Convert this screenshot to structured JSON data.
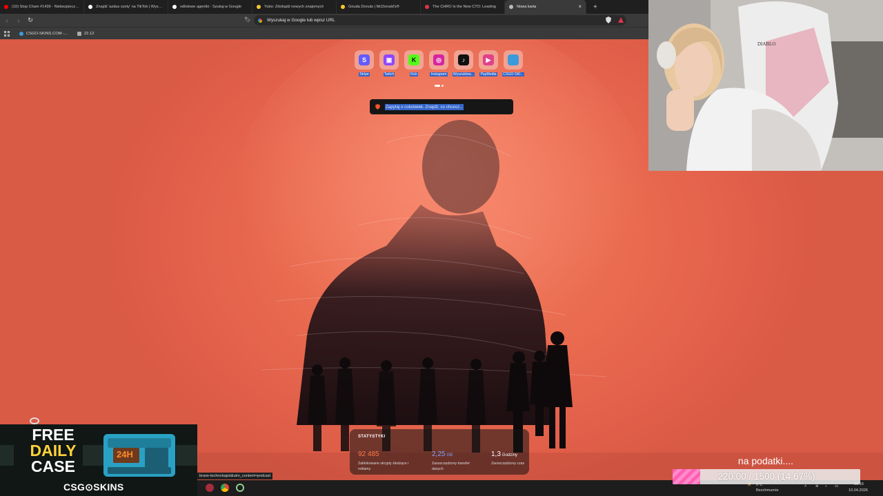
{
  "browser": {
    "tabs": [
      {
        "title": "(10) Stop Cham #1439 - Niebezpieczne",
        "favicon_color": "#ff0000",
        "active": false
      },
      {
        "title": "Znajdź 'azdus szoty' na TikTok | Wyszukaj",
        "favicon_color": "#ffffff",
        "active": false
      },
      {
        "title": "odlotowe agentki - Szukaj w Google",
        "favicon_color": "#ffffff",
        "active": false
      },
      {
        "title": "Yubo: Zdobądź nowych znajomych",
        "favicon_color": "#f4c534",
        "active": false
      },
      {
        "title": "Gouda Donuts | McDonald's®",
        "favicon_color": "#ffc72c",
        "active": false
      },
      {
        "title": "The CHRO Is the New CTO: Leading",
        "favicon_color": "#e0334b",
        "active": false
      },
      {
        "title": "Nowa karta",
        "favicon_color": "#bbbbbb",
        "active": true
      }
    ],
    "new_tab_symbol": "+",
    "address_bar": {
      "placeholder": "Wyszukaj w Google lub wpisz URL"
    },
    "bookmarks": [
      {
        "label": "CSGO-SKINS.COM -...",
        "favicon_color": "#3a9bdc"
      },
      {
        "label": "22.12",
        "favicon_color": "#aaaaaa"
      }
    ],
    "shortcuts": [
      {
        "label": "Stripe",
        "icon": "stripe-icon",
        "color": "#635bff",
        "glyph": "S"
      },
      {
        "label": "Twitch",
        "icon": "twitch-icon",
        "color": "#9146ff",
        "glyph": "▣"
      },
      {
        "label": "Kick",
        "icon": "kick-icon",
        "color": "#53fc18",
        "glyph": "K"
      },
      {
        "label": "Instagram",
        "icon": "instagram-icon",
        "color": "#d6249f",
        "glyph": "◎"
      },
      {
        "label": "Wyszukiwa...",
        "icon": "tiktok-icon",
        "color": "#111111",
        "glyph": "♪"
      },
      {
        "label": "PayMedia",
        "icon": "paymedia-icon",
        "color": "#e0418a",
        "glyph": "▶"
      },
      {
        "label": "CSGO-SKI...",
        "icon": "csgo-skins-icon",
        "color": "#3a9bdc",
        "glyph": ""
      }
    ],
    "ai_search": {
      "placeholder": "Zapytaj o cokolwiek. Znajdź, co chcesz..."
    },
    "stats": {
      "title": "STATYSTYKI",
      "items": [
        {
          "value": "92 485",
          "unit": "",
          "description": "Zablokowane skrypty śledzące i reklamy",
          "color": "#ff7a45"
        },
        {
          "value": "2,25",
          "unit": "GB",
          "description": "Zaoszczędzony transfer danych",
          "color": "#7fa4ff"
        },
        {
          "value": "1,3",
          "unit": "Godziny",
          "description": "Zaoszczędzony czas",
          "color": "#ffffff"
        }
      ]
    },
    "status_url": "brave-technologist&utm_content=podcast"
  },
  "taskbar": {
    "tray": {
      "weather": "Bezchmurnie",
      "temp": "5°C",
      "time": "20:16",
      "date": "10.04.2026"
    }
  },
  "overlay": {
    "sponsor": {
      "headline_lines": [
        "FREE",
        "DAILY",
        "CASE"
      ],
      "badge": "24H",
      "brand": "CSG⊙SKINS"
    },
    "goal": {
      "text": "na podatki....",
      "current": 220.0,
      "target": 1500,
      "percent": 14.67,
      "label": "220.00 / 1500 (14.67%)"
    }
  }
}
